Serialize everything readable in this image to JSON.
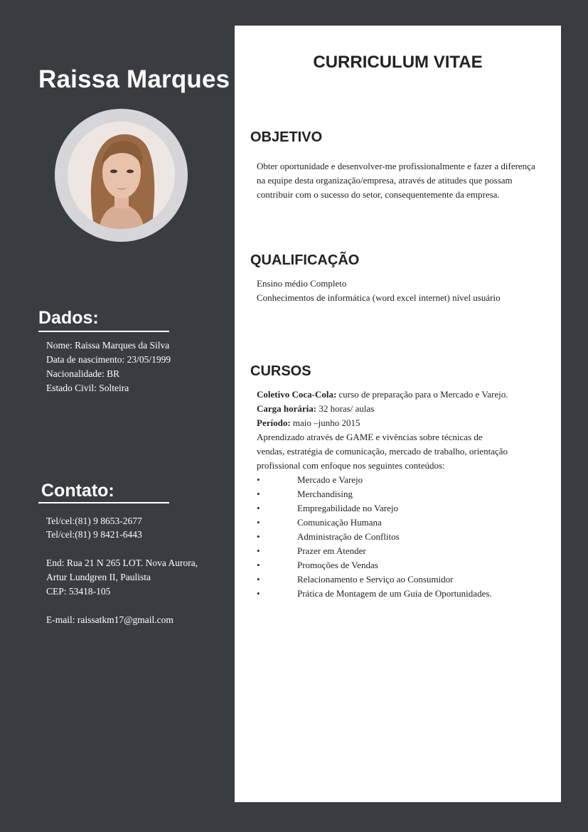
{
  "sidebar": {
    "name": "Raissa Marques",
    "dados_heading": "Dados:",
    "dados": [
      "Nome: Raissa Marques da Silva",
      "Data de nascimento: 23/05/1999",
      "Nacionalidade: BR",
      "Estado Civil: Solteira"
    ],
    "contato_heading": "Contato:",
    "tel1": "Tel/cel:(81) 9 8653-2677",
    "tel2": "Tel/cel:(81) 9 8421-6443",
    "address": [
      "End: Rua 21 N 265 LOT. Nova Aurora,",
      "Artur Lundgren II, Paulista",
      "CEP: 53418-105"
    ],
    "email": "E-mail: raissatkm17@gmail.com"
  },
  "main": {
    "title": "CURRICULUM VITAE",
    "objetivo": {
      "heading": "OBJETIVO",
      "lines": [
        "Obter oportunidade e desenvolver-me profissionalmente e fazer a diferença",
        "na equipe desta organização/empresa, através de atitudes que possam",
        "contribuir com o sucesso do setor, consequentemente da empresa."
      ]
    },
    "qualificacao": {
      "heading": "QUALIFICAÇÃO",
      "lines": [
        "Ensino médio Completo",
        "Conhecimentos de informática (word excel internet) nível usuário"
      ]
    },
    "cursos": {
      "heading": "CURSOS",
      "course_label": "Coletivo Coca-Cola:",
      "course_value": " curso de preparação para o Mercado e Varejo.",
      "hours_label": "Carga horária:",
      "hours_value": " 32 horas/ aulas",
      "period_label": "Período:",
      "period_value": " maio –junho 2015",
      "desc": [
        "Aprendizado através de GAME e vivências sobre técnicas de",
        "vendas, estratégia de comunicação, mercado de trabalho, orientação",
        "profissional com enfoque nos seguintes conteúdos:"
      ],
      "bullet": "•",
      "topics": [
        "Mercado e Varejo",
        "Merchandising",
        "Empregabilidade no Varejo",
        "Comunicação Humana",
        "Administração de Conflitos",
        "Prazer em Atender",
        "Promoções de Vendas",
        "Relacionamento e Serviço ao Consumidor",
        "Prática de Montagem de um Guia de Oportunidades."
      ]
    }
  }
}
